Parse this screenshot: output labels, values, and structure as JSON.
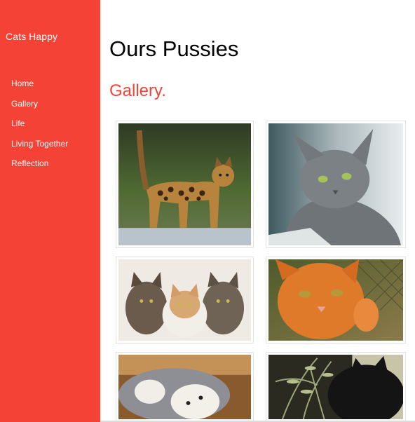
{
  "sidebar": {
    "brand": "Cats Happy",
    "items": [
      {
        "label": "Home"
      },
      {
        "label": "Gallery"
      },
      {
        "label": "Life"
      },
      {
        "label": "Living Together"
      },
      {
        "label": "Reflection"
      }
    ]
  },
  "main": {
    "title": "Ours Pussies",
    "subtitle": "Gallery."
  },
  "gallery": {
    "photos": [
      {
        "subject": "bengal-cat-photo"
      },
      {
        "subject": "gray-cat-photo"
      },
      {
        "subject": "three-cats-photo"
      },
      {
        "subject": "orange-cat-photo"
      },
      {
        "subject": "lying-cat-photo"
      },
      {
        "subject": "black-cat-photo"
      }
    ]
  },
  "colors": {
    "accent": "#f44336",
    "background": "#ffffff"
  }
}
